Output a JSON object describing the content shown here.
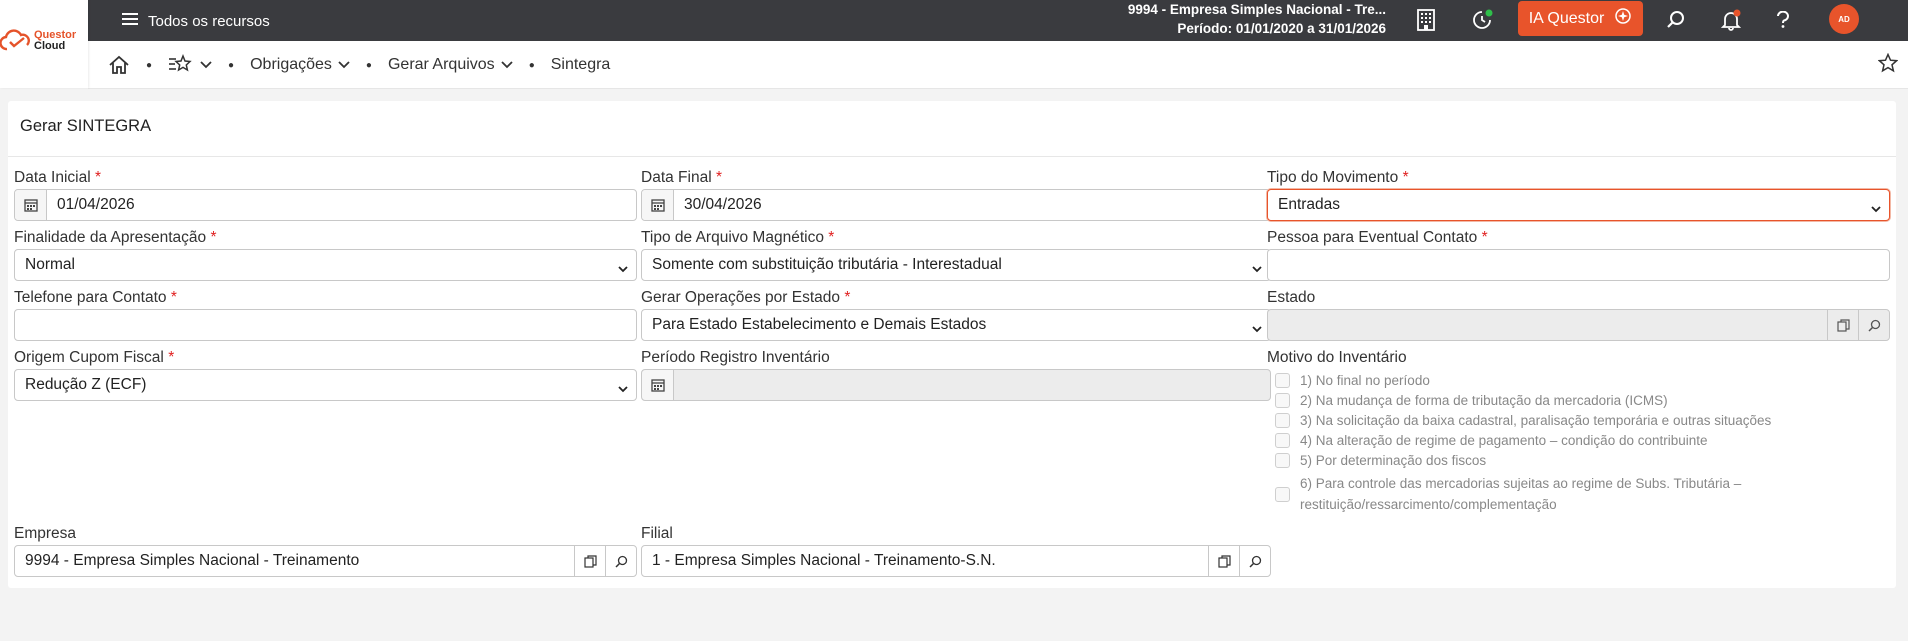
{
  "app": {
    "logo_line1": "Questor",
    "logo_line2": "Cloud",
    "menu_label": "Todos os recursos",
    "company_line": "9994 - Empresa Simples Nacional - Tre...",
    "period_line": "Período: 01/01/2020 a 31/01/2026",
    "ia_label": "IA Questor",
    "avatar_initials": "AD",
    "accent_color": "#e8542b"
  },
  "breadcrumb": {
    "items": [
      "Obrigações",
      "Gerar Arquivos",
      "Sintegra"
    ]
  },
  "page": {
    "title": "Gerar SINTEGRA"
  },
  "form": {
    "data_inicial": {
      "label": "Data Inicial",
      "value": "01/04/2026"
    },
    "data_final": {
      "label": "Data Final",
      "value": "30/04/2026"
    },
    "tipo_movimento": {
      "label": "Tipo do Movimento",
      "value": "Entradas"
    },
    "finalidade": {
      "label": "Finalidade da Apresentação",
      "value": "Normal"
    },
    "tipo_arquivo": {
      "label": "Tipo de Arquivo Magnético",
      "value": "Somente com substituição tributária - Interestadual"
    },
    "pessoa_contato": {
      "label": "Pessoa para Eventual Contato",
      "value": ""
    },
    "telefone": {
      "label": "Telefone para Contato",
      "value": ""
    },
    "operacoes_estado": {
      "label": "Gerar Operações por Estado",
      "value": "Para Estado Estabelecimento e Demais Estados"
    },
    "estado": {
      "label": "Estado",
      "value": ""
    },
    "origem_cupom": {
      "label": "Origem Cupom Fiscal",
      "value": "Redução Z (ECF)"
    },
    "periodo_inventario": {
      "label": "Período Registro Inventário",
      "value": ""
    },
    "motivo_inventario": {
      "label": "Motivo do Inventário",
      "options": [
        "1) No final no período",
        "2) Na mudança de forma de tributação da mercadoria (ICMS)",
        "3) Na solicitação da baixa cadastral, paralisação temporária e outras situações",
        "4) Na alteração de regime de pagamento – condição do contribuinte",
        "5) Por determinação dos fiscos",
        "6) Para controle das mercadorias sujeitas ao regime de Subs. Tributária – restituição/ressarcimento/complementação"
      ]
    },
    "empresa": {
      "label": "Empresa",
      "value": "9994 - Empresa Simples Nacional - Treinamento"
    },
    "filial": {
      "label": "Filial",
      "value": "1 - Empresa Simples Nacional - Treinamento-S.N."
    },
    "required_mark": "*"
  }
}
